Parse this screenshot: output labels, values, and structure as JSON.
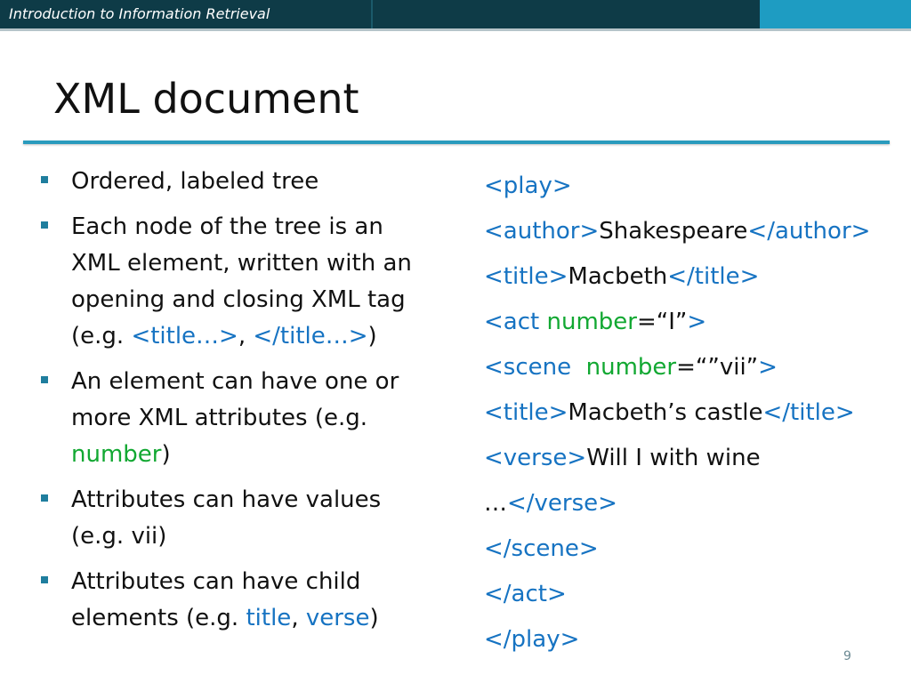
{
  "header": {
    "text": "Introduction to Information Retrieval"
  },
  "slide": {
    "title": "XML document",
    "page_number": "9"
  },
  "bullets": {
    "b1": "Ordered, labeled tree",
    "b2": {
      "text": "Each node of the tree is an XML element, written with an opening and closing XML tag (e.g. ",
      "tag1": "<title…>",
      "sep": ", ",
      "tag2": "</title…>",
      "end": ")"
    },
    "b3": {
      "text": "An element can have one or more XML attributes (e.g. ",
      "attr": "number",
      "end": ")"
    },
    "b4": "Attributes can have values (e.g. vii)",
    "b5": {
      "text": "Attributes can have  child elements (e.g. ",
      "c1": "title",
      "sep": ", ",
      "c2": "verse",
      "end": ")"
    }
  },
  "code": {
    "l1": {
      "tag": "<play>"
    },
    "l2": {
      "open": "<author>",
      "text": "Shakespeare",
      "close": "</author>"
    },
    "l3": {
      "open": "<title>",
      "text": "Macbeth",
      "close": "</title>"
    },
    "l4": {
      "open": "<act ",
      "attr": "number",
      "eq": "=“I”",
      "close": ">"
    },
    "l5": {
      "open": "<scene  ",
      "attr": "number",
      "eq": "=“”vii”",
      "close": ">"
    },
    "l6": {
      "open": "<title>",
      "text": "Macbeth’s castle",
      "close": "</title>"
    },
    "l7": {
      "open": "<verse>",
      "text": "Will I with wine"
    },
    "l8": {
      "text": "…",
      "close": "</verse>"
    },
    "l9": {
      "tag": "</scene>"
    },
    "l10": {
      "tag": "</act>"
    },
    "l11": {
      "tag": "</play>"
    }
  },
  "colors": {
    "tag": "#1673c2",
    "attribute": "#12a832",
    "header_bg": "#0e3b47",
    "accent": "#1e9cc2"
  }
}
